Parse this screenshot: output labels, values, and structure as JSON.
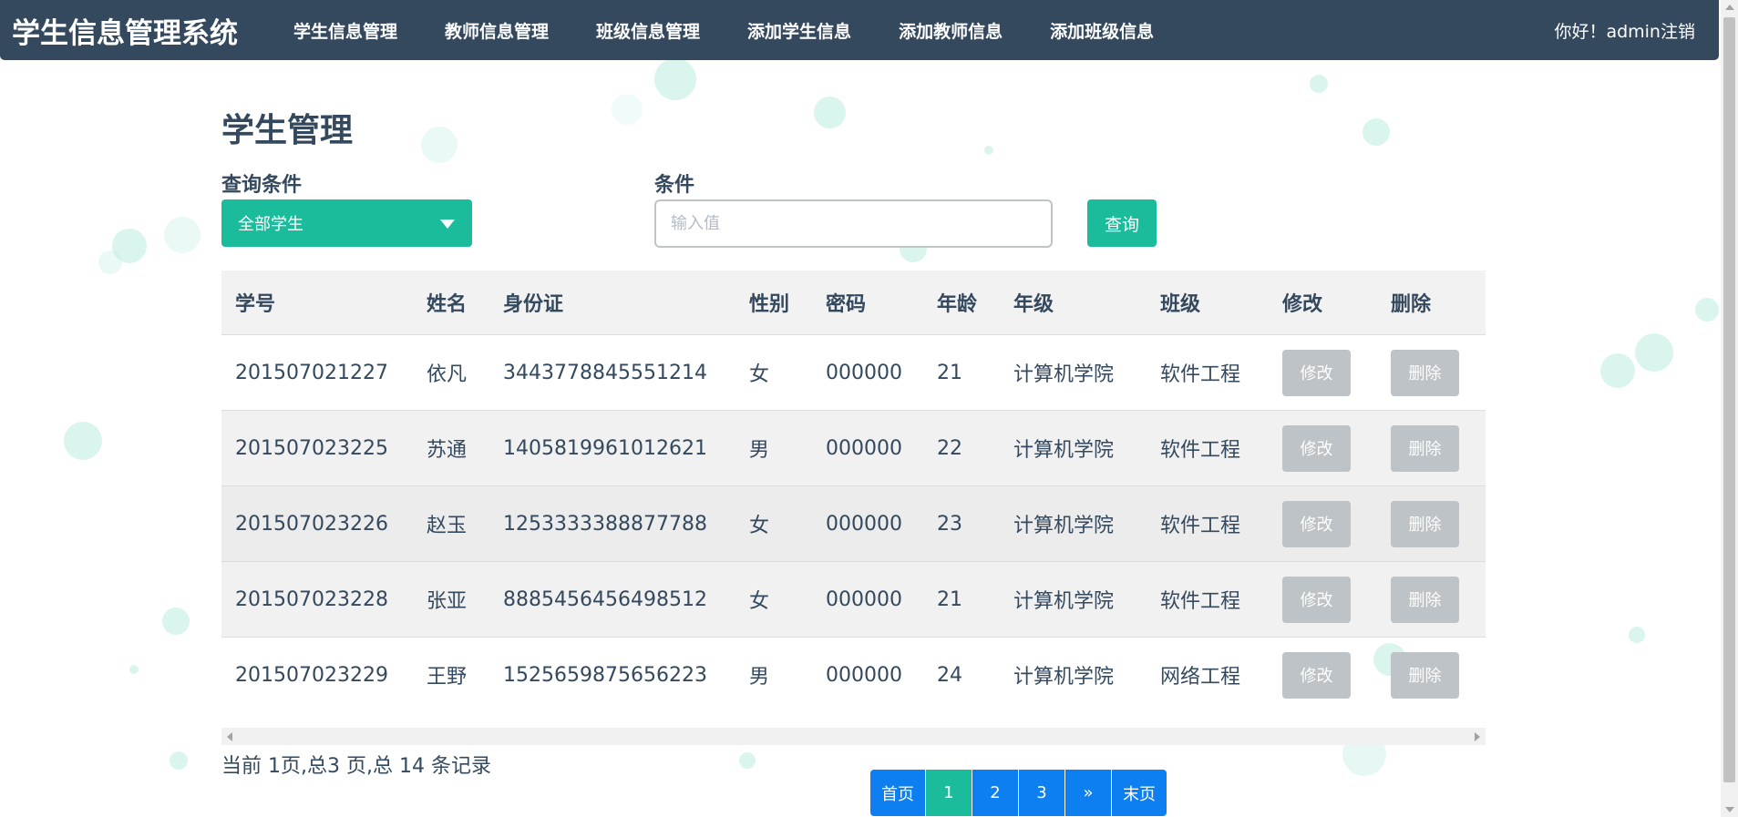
{
  "navbar": {
    "brand": "学生信息管理系统",
    "items": [
      {
        "label": "学生信息管理"
      },
      {
        "label": "教师信息管理"
      },
      {
        "label": "班级信息管理"
      },
      {
        "label": "添加学生信息"
      },
      {
        "label": "添加教师信息"
      },
      {
        "label": "添加班级信息"
      }
    ],
    "greeting": "你好！admin",
    "logout": "注销"
  },
  "main": {
    "title": "学生管理",
    "query_label": "查询条件",
    "query_select_value": "全部学生",
    "condition_label": "条件",
    "condition_placeholder": "输入值",
    "query_button": "查询"
  },
  "table": {
    "headers": [
      "学号",
      "姓名",
      "身份证",
      "性别",
      "密码",
      "年龄",
      "年级",
      "班级",
      "修改",
      "删除"
    ],
    "rows": [
      {
        "id": "201507021227",
        "name": "依凡",
        "idcard": "3443778845551214",
        "gender": "女",
        "password": "000000",
        "age": "21",
        "grade": "计算机学院",
        "class": "软件工程",
        "edit": "修改",
        "delete": "删除"
      },
      {
        "id": "201507023225",
        "name": "苏通",
        "idcard": "1405819961012621",
        "gender": "男",
        "password": "000000",
        "age": "22",
        "grade": "计算机学院",
        "class": "软件工程",
        "edit": "修改",
        "delete": "删除"
      },
      {
        "id": "201507023226",
        "name": "赵玉",
        "idcard": "1253333388877788",
        "gender": "女",
        "password": "000000",
        "age": "23",
        "grade": "计算机学院",
        "class": "软件工程",
        "edit": "修改",
        "delete": "删除"
      },
      {
        "id": "201507023228",
        "name": "张亚",
        "idcard": "8885456456498512",
        "gender": "女",
        "password": "000000",
        "age": "21",
        "grade": "计算机学院",
        "class": "软件工程",
        "edit": "修改",
        "delete": "删除"
      },
      {
        "id": "201507023229",
        "name": "王野",
        "idcard": "1525659875656223",
        "gender": "男",
        "password": "000000",
        "age": "24",
        "grade": "计算机学院",
        "class": "网络工程",
        "edit": "修改",
        "delete": "删除"
      }
    ]
  },
  "summary": "当前 1页,总3 页,总 14 条记录",
  "pagination": {
    "first": "首页",
    "pages": [
      "1",
      "2",
      "3"
    ],
    "current": "1",
    "next": "»",
    "last": "末页"
  },
  "colors": {
    "navbar": "#34495e",
    "accent": "#1abc9c",
    "page_button": "#0d7ff0",
    "disabled_button": "#bdc3c7",
    "bubble": "#b9ece0"
  }
}
